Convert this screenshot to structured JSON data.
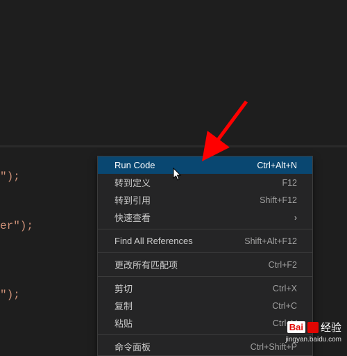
{
  "code": {
    "line1": "\");",
    "line2": "er\");",
    "line3": "\");"
  },
  "contextMenu": {
    "items": [
      {
        "label": "Run Code",
        "shortcut": "Ctrl+Alt+N",
        "highlighted": true
      },
      {
        "label": "转到定义",
        "shortcut": "F12"
      },
      {
        "label": "转到引用",
        "shortcut": "Shift+F12"
      },
      {
        "label": "快速查看",
        "submenu": true
      },
      {
        "separator": true
      },
      {
        "label": "Find All References",
        "shortcut": "Shift+Alt+F12"
      },
      {
        "separator": true
      },
      {
        "label": "更改所有匹配项",
        "shortcut": "Ctrl+F2"
      },
      {
        "separator": true
      },
      {
        "label": "剪切",
        "shortcut": "Ctrl+X"
      },
      {
        "label": "复制",
        "shortcut": "Ctrl+C"
      },
      {
        "label": "粘贴",
        "shortcut": "Ctrl+V"
      },
      {
        "separator": true
      },
      {
        "label": "命令面板",
        "shortcut": "Ctrl+Shift+P"
      }
    ]
  },
  "watermark": {
    "brand1": "Bai",
    "brand2": "经验",
    "url": "jingyan.baidu.com"
  }
}
